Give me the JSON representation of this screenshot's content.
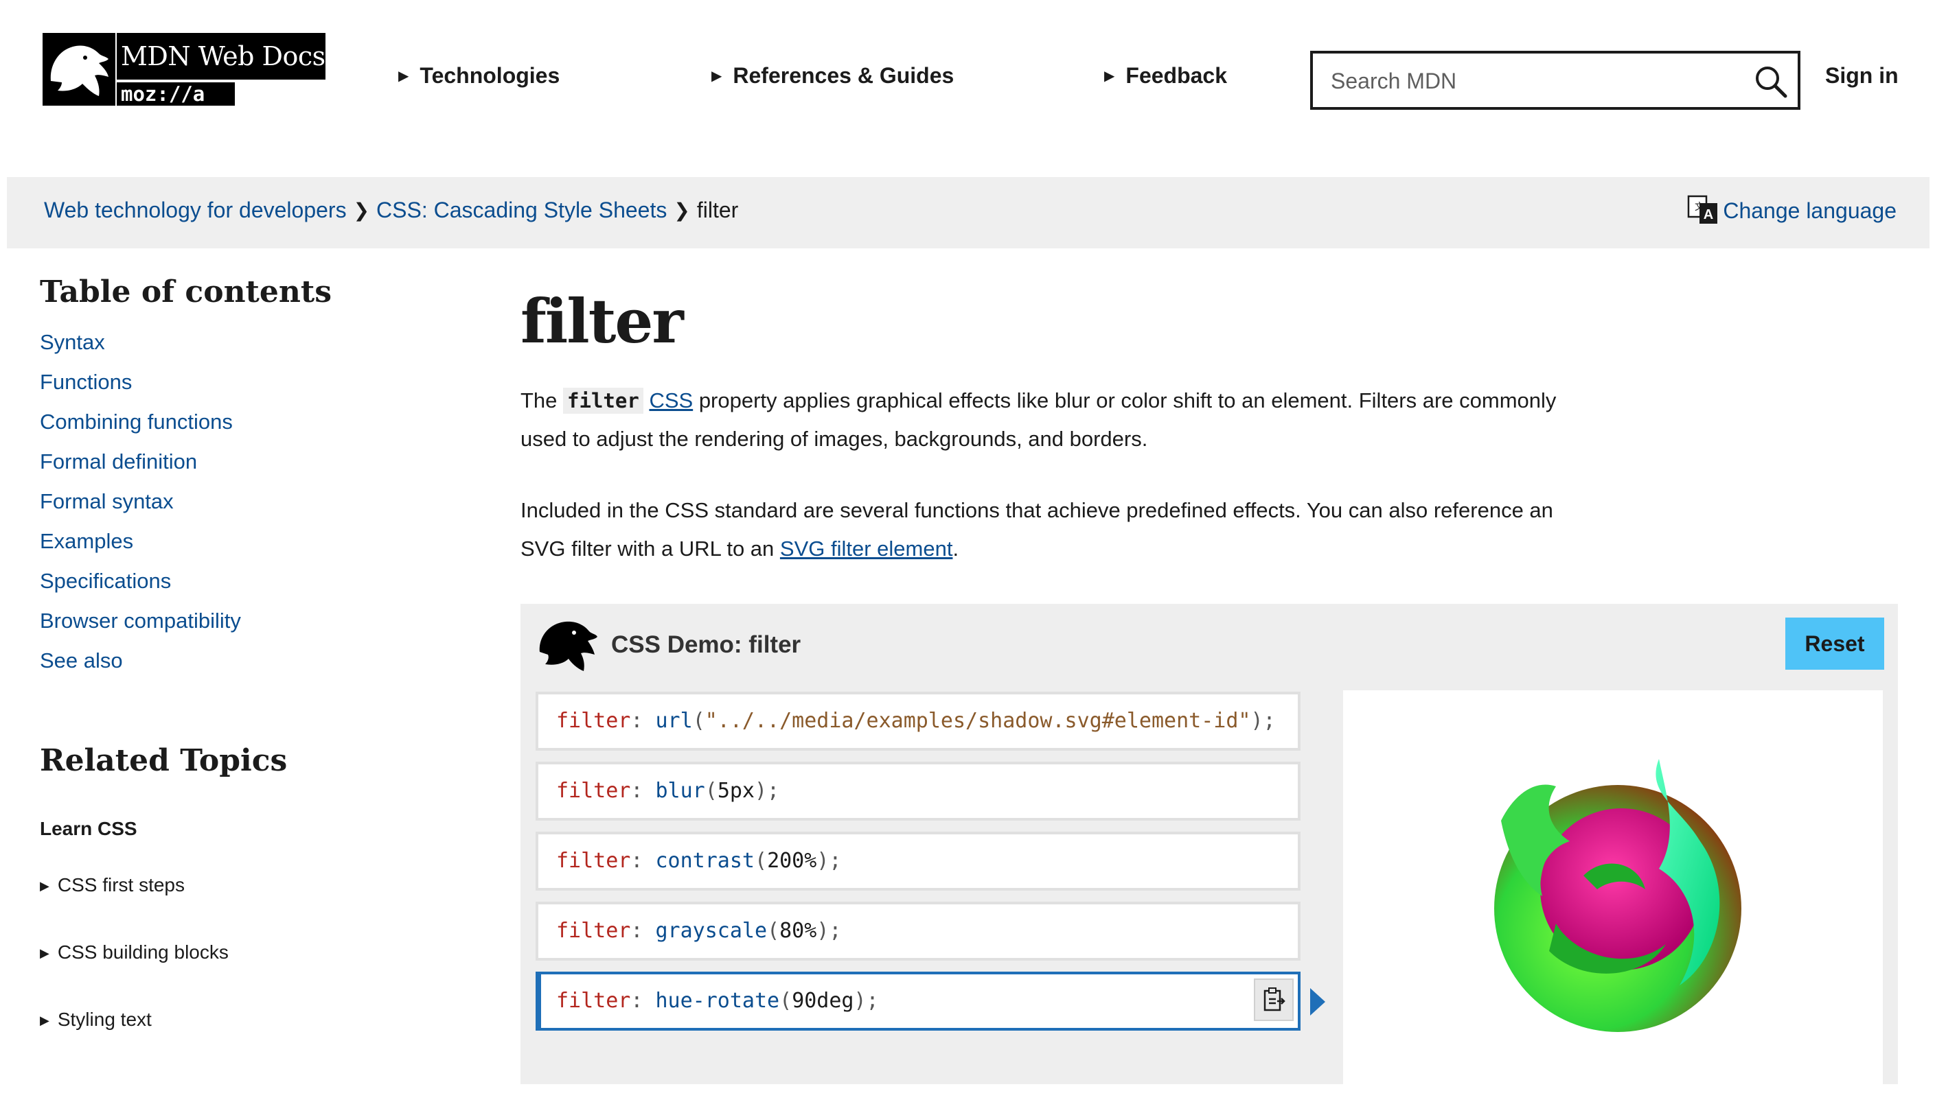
{
  "header": {
    "logo": {
      "text": "MDN Web Docs",
      "sub": "moz://a"
    },
    "nav": [
      {
        "label": "Technologies"
      },
      {
        "label": "References & Guides"
      },
      {
        "label": "Feedback"
      }
    ],
    "search": {
      "placeholder": "Search MDN",
      "value": ""
    },
    "sign_in": "Sign in"
  },
  "breadcrumb": {
    "items": [
      "Web technology for developers",
      "CSS: Cascading Style Sheets"
    ],
    "current": "filter",
    "change_language": "Change language"
  },
  "sidebar": {
    "toc_title": "Table of contents",
    "toc": [
      "Syntax",
      "Functions",
      "Combining functions",
      "Formal definition",
      "Formal syntax",
      "Examples",
      "Specifications",
      "Browser compatibility",
      "See also"
    ],
    "related_title": "Related Topics",
    "learn_title": "Learn CSS",
    "related_items": [
      "CSS first steps",
      "CSS building blocks",
      "Styling text"
    ]
  },
  "main": {
    "title": "filter",
    "intro": {
      "the": "The",
      "code": "filter",
      "css_link": "CSS",
      "rest_line1": "property applies graphical effects like blur or color shift to an element. Filters are commonly used to adjust the rendering of images, backgrounds, and borders."
    },
    "para2": {
      "text": "Included in the CSS standard are several functions that achieve predefined effects. You can also reference an SVG filter with a URL to an",
      "link": "SVG filter element",
      "end": "."
    }
  },
  "demo": {
    "title": "CSS Demo: filter",
    "reset_label": "Reset",
    "choices": [
      {
        "prop": "filter",
        "fn": "url",
        "arg": "\"../../media/examples/shadow.svg#element-id\"",
        "arg_type": "str"
      },
      {
        "prop": "filter",
        "fn": "blur",
        "arg": "5px",
        "arg_type": "num"
      },
      {
        "prop": "filter",
        "fn": "contrast",
        "arg": "200%",
        "arg_type": "num"
      },
      {
        "prop": "filter",
        "fn": "grayscale",
        "arg": "80%",
        "arg_type": "num"
      },
      {
        "prop": "filter",
        "fn": "hue-rotate",
        "arg": "90deg",
        "arg_type": "num",
        "selected": true
      }
    ],
    "colors": {
      "accent": "#1f6fb8",
      "reset_bg": "#4fc3f7",
      "link": "#0b4d8f"
    }
  }
}
